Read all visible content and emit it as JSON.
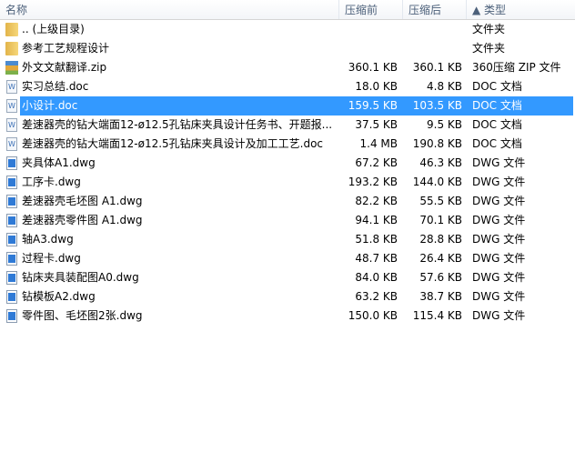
{
  "columns": {
    "name": "名称",
    "size": "压缩前",
    "packed": "压缩后",
    "type": "▲ 类型"
  },
  "files": [
    {
      "name": ".. (上级目录)",
      "size": "",
      "packed": "",
      "type": "文件夹",
      "icon": "folder"
    },
    {
      "name": "参考工艺规程设计",
      "size": "",
      "packed": "",
      "type": "文件夹",
      "icon": "folder"
    },
    {
      "name": "外文文献翻译.zip",
      "size": "360.1 KB",
      "packed": "360.1 KB",
      "type": "360压缩 ZIP 文件",
      "icon": "zip"
    },
    {
      "name": "实习总结.doc",
      "size": "18.0 KB",
      "packed": "4.8 KB",
      "type": "DOC 文档",
      "icon": "doc"
    },
    {
      "name": "小设计.doc",
      "size": "159.5 KB",
      "packed": "103.5 KB",
      "type": "DOC 文档",
      "icon": "doc",
      "selected": true
    },
    {
      "name": "差速器壳的钻大端面12-ø12.5孔钻床夹具设计任务书、开题报...",
      "size": "37.5 KB",
      "packed": "9.5 KB",
      "type": "DOC 文档",
      "icon": "doc"
    },
    {
      "name": "差速器壳的钻大端面12-ø12.5孔钻床夹具设计及加工工艺.doc",
      "size": "1.4 MB",
      "packed": "190.8 KB",
      "type": "DOC 文档",
      "icon": "doc"
    },
    {
      "name": "夹具体A1.dwg",
      "size": "67.2 KB",
      "packed": "46.3 KB",
      "type": "DWG 文件",
      "icon": "dwg"
    },
    {
      "name": "工序卡.dwg",
      "size": "193.2 KB",
      "packed": "144.0 KB",
      "type": "DWG 文件",
      "icon": "dwg"
    },
    {
      "name": "差速器壳毛坯图 A1.dwg",
      "size": "82.2 KB",
      "packed": "55.5 KB",
      "type": "DWG 文件",
      "icon": "dwg"
    },
    {
      "name": "差速器壳零件图 A1.dwg",
      "size": "94.1 KB",
      "packed": "70.1 KB",
      "type": "DWG 文件",
      "icon": "dwg"
    },
    {
      "name": "轴A3.dwg",
      "size": "51.8 KB",
      "packed": "28.8 KB",
      "type": "DWG 文件",
      "icon": "dwg"
    },
    {
      "name": "过程卡.dwg",
      "size": "48.7 KB",
      "packed": "26.4 KB",
      "type": "DWG 文件",
      "icon": "dwg"
    },
    {
      "name": "钻床夹具装配图A0.dwg",
      "size": "84.0 KB",
      "packed": "57.6 KB",
      "type": "DWG 文件",
      "icon": "dwg"
    },
    {
      "name": "钻模板A2.dwg",
      "size": "63.2 KB",
      "packed": "38.7 KB",
      "type": "DWG 文件",
      "icon": "dwg"
    },
    {
      "name": "零件图、毛坯图2张.dwg",
      "size": "150.0 KB",
      "packed": "115.4 KB",
      "type": "DWG 文件",
      "icon": "dwg"
    }
  ]
}
